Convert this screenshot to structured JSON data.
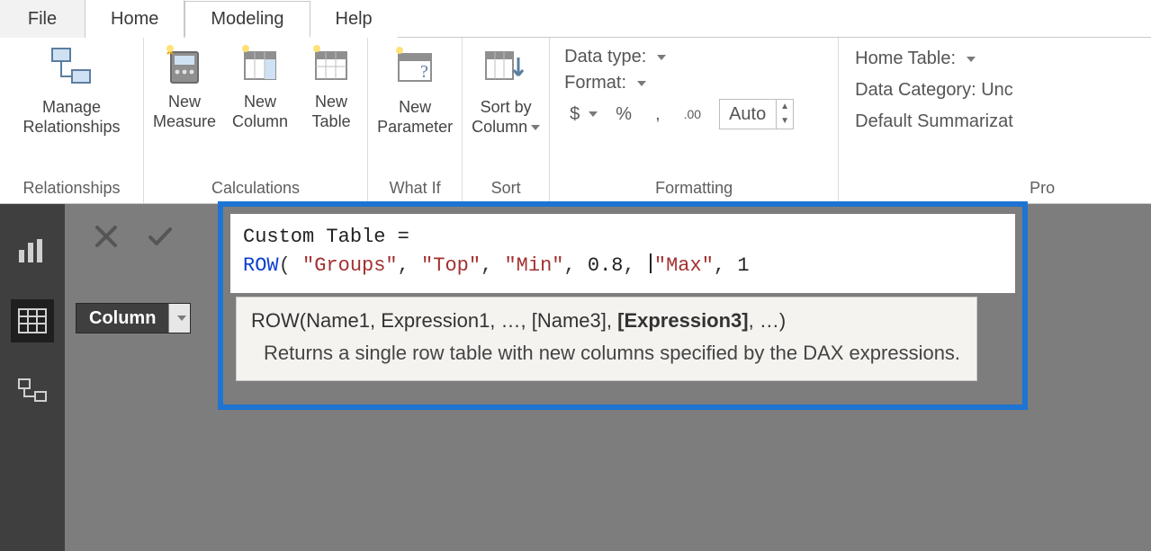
{
  "tabs": {
    "file": "File",
    "home": "Home",
    "modeling": "Modeling",
    "help": "Help"
  },
  "ribbon": {
    "relationships": {
      "manage": "Manage\nRelationships",
      "group_label": "Relationships"
    },
    "calculations": {
      "new_measure": "New\nMeasure",
      "new_column": "New\nColumn",
      "new_table": "New\nTable",
      "group_label": "Calculations"
    },
    "whatif": {
      "new_parameter": "New\nParameter",
      "group_label": "What If"
    },
    "sort": {
      "sort_by_column": "Sort by\nColumn",
      "group_label": "Sort"
    },
    "formatting": {
      "data_type_label": "Data type:",
      "format_label": "Format:",
      "currency_symbol": "$",
      "percent_symbol": "%",
      "thousands_symbol": ",",
      "decimal_symbol": ".00",
      "auto_value": "Auto",
      "group_label": "Formatting"
    },
    "properties": {
      "home_table_label": "Home Table:",
      "data_category_label": "Data Category: Unc",
      "default_summarization_label": "Default Summarizat",
      "group_label": "Pro"
    }
  },
  "leftnav": {
    "report": "report-view",
    "data": "data-view",
    "model": "model-view"
  },
  "fieldwell": {
    "column_label": "Column"
  },
  "formula": {
    "line1": "Custom Table =",
    "keyword": "ROW",
    "open": "( ",
    "arg1": "\"Groups\"",
    "arg2": "\"Top\"",
    "arg3": "\"Min\"",
    "arg4": "0.8",
    "arg5": "\"Max\"",
    "arg6": "1",
    "tooltip_sig_pre": "ROW(Name1, Expression1, …, [Name3], ",
    "tooltip_sig_cur": "[Expression3]",
    "tooltip_sig_post": ", …)",
    "tooltip_desc": "Returns a single row table with new columns specified by the DAX expressions."
  }
}
